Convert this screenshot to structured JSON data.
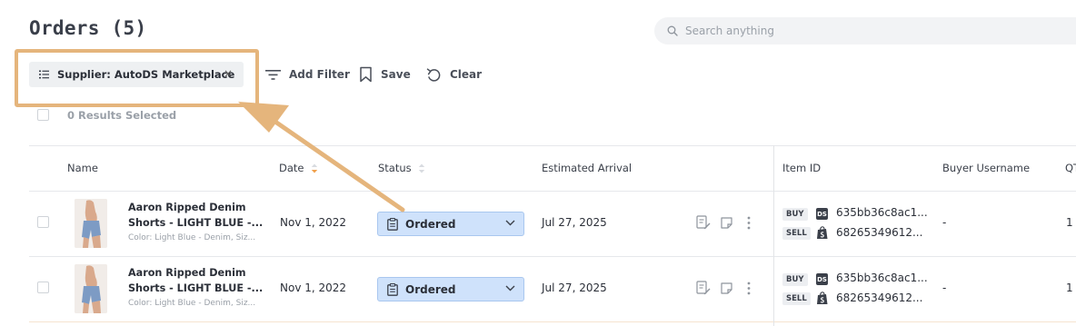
{
  "header": {
    "title": "Orders (5)",
    "search_placeholder": "Search anything"
  },
  "toolbar": {
    "filter_chip_label": "Supplier: AutoDS Marketplace",
    "filter_chip_close": "×",
    "add_filter_label": "Add Filter",
    "save_label": "Save",
    "clear_label": "Clear"
  },
  "selection": {
    "results_selected": "0 Results Selected"
  },
  "table": {
    "columns": {
      "name": "Name",
      "date": "Date",
      "status": "Status",
      "estimated_arrival": "Estimated Arrival",
      "item_id": "Item ID",
      "buyer_username": "Buyer Username",
      "qty": "QT"
    },
    "rows": [
      {
        "name_line1": "Aaron Ripped Denim",
        "name_line2": "Shorts - LIGHT BLUE -...",
        "variant": "Color: Light Blue - Denim, Siz...",
        "date": "Nov 1, 2022",
        "status": "Ordered",
        "estimated_arrival": "Jul 27, 2025",
        "buy_tag": "BUY",
        "buy_source_badge": "DS",
        "buy_id": "635bb36c8ac1...",
        "sell_tag": "SELL",
        "sell_id": "68265349612...",
        "buyer_username": "-",
        "qty": "1"
      },
      {
        "name_line1": "Aaron Ripped Denim",
        "name_line2": "Shorts - LIGHT BLUE -...",
        "variant": "Color: Light Blue - Denim, Siz...",
        "date": "Nov 1, 2022",
        "status": "Ordered",
        "estimated_arrival": "Jul 27, 2025",
        "buy_tag": "BUY",
        "buy_source_badge": "DS",
        "buy_id": "635bb36c8ac1...",
        "sell_tag": "SELL",
        "sell_id": "68265349612...",
        "buyer_username": "-",
        "qty": "1"
      }
    ]
  },
  "icons": {
    "search": "search-icon",
    "filter_list": "list-icon",
    "add_filter": "filter-icon",
    "save": "bookmark-icon",
    "clear": "undo-icon",
    "sort": "sort-icon",
    "status": "clipboard-icon",
    "dropdown": "chevron-down-icon",
    "notes": "edit-note-icon",
    "message": "message-icon",
    "more": "more-vertical-icon",
    "shopify": "shopify-icon"
  },
  "colors": {
    "highlight": "#e5b57c",
    "status_bg": "#cfe2fb",
    "status_border": "#a9c7ef",
    "sort_active": "#f0a04b"
  }
}
